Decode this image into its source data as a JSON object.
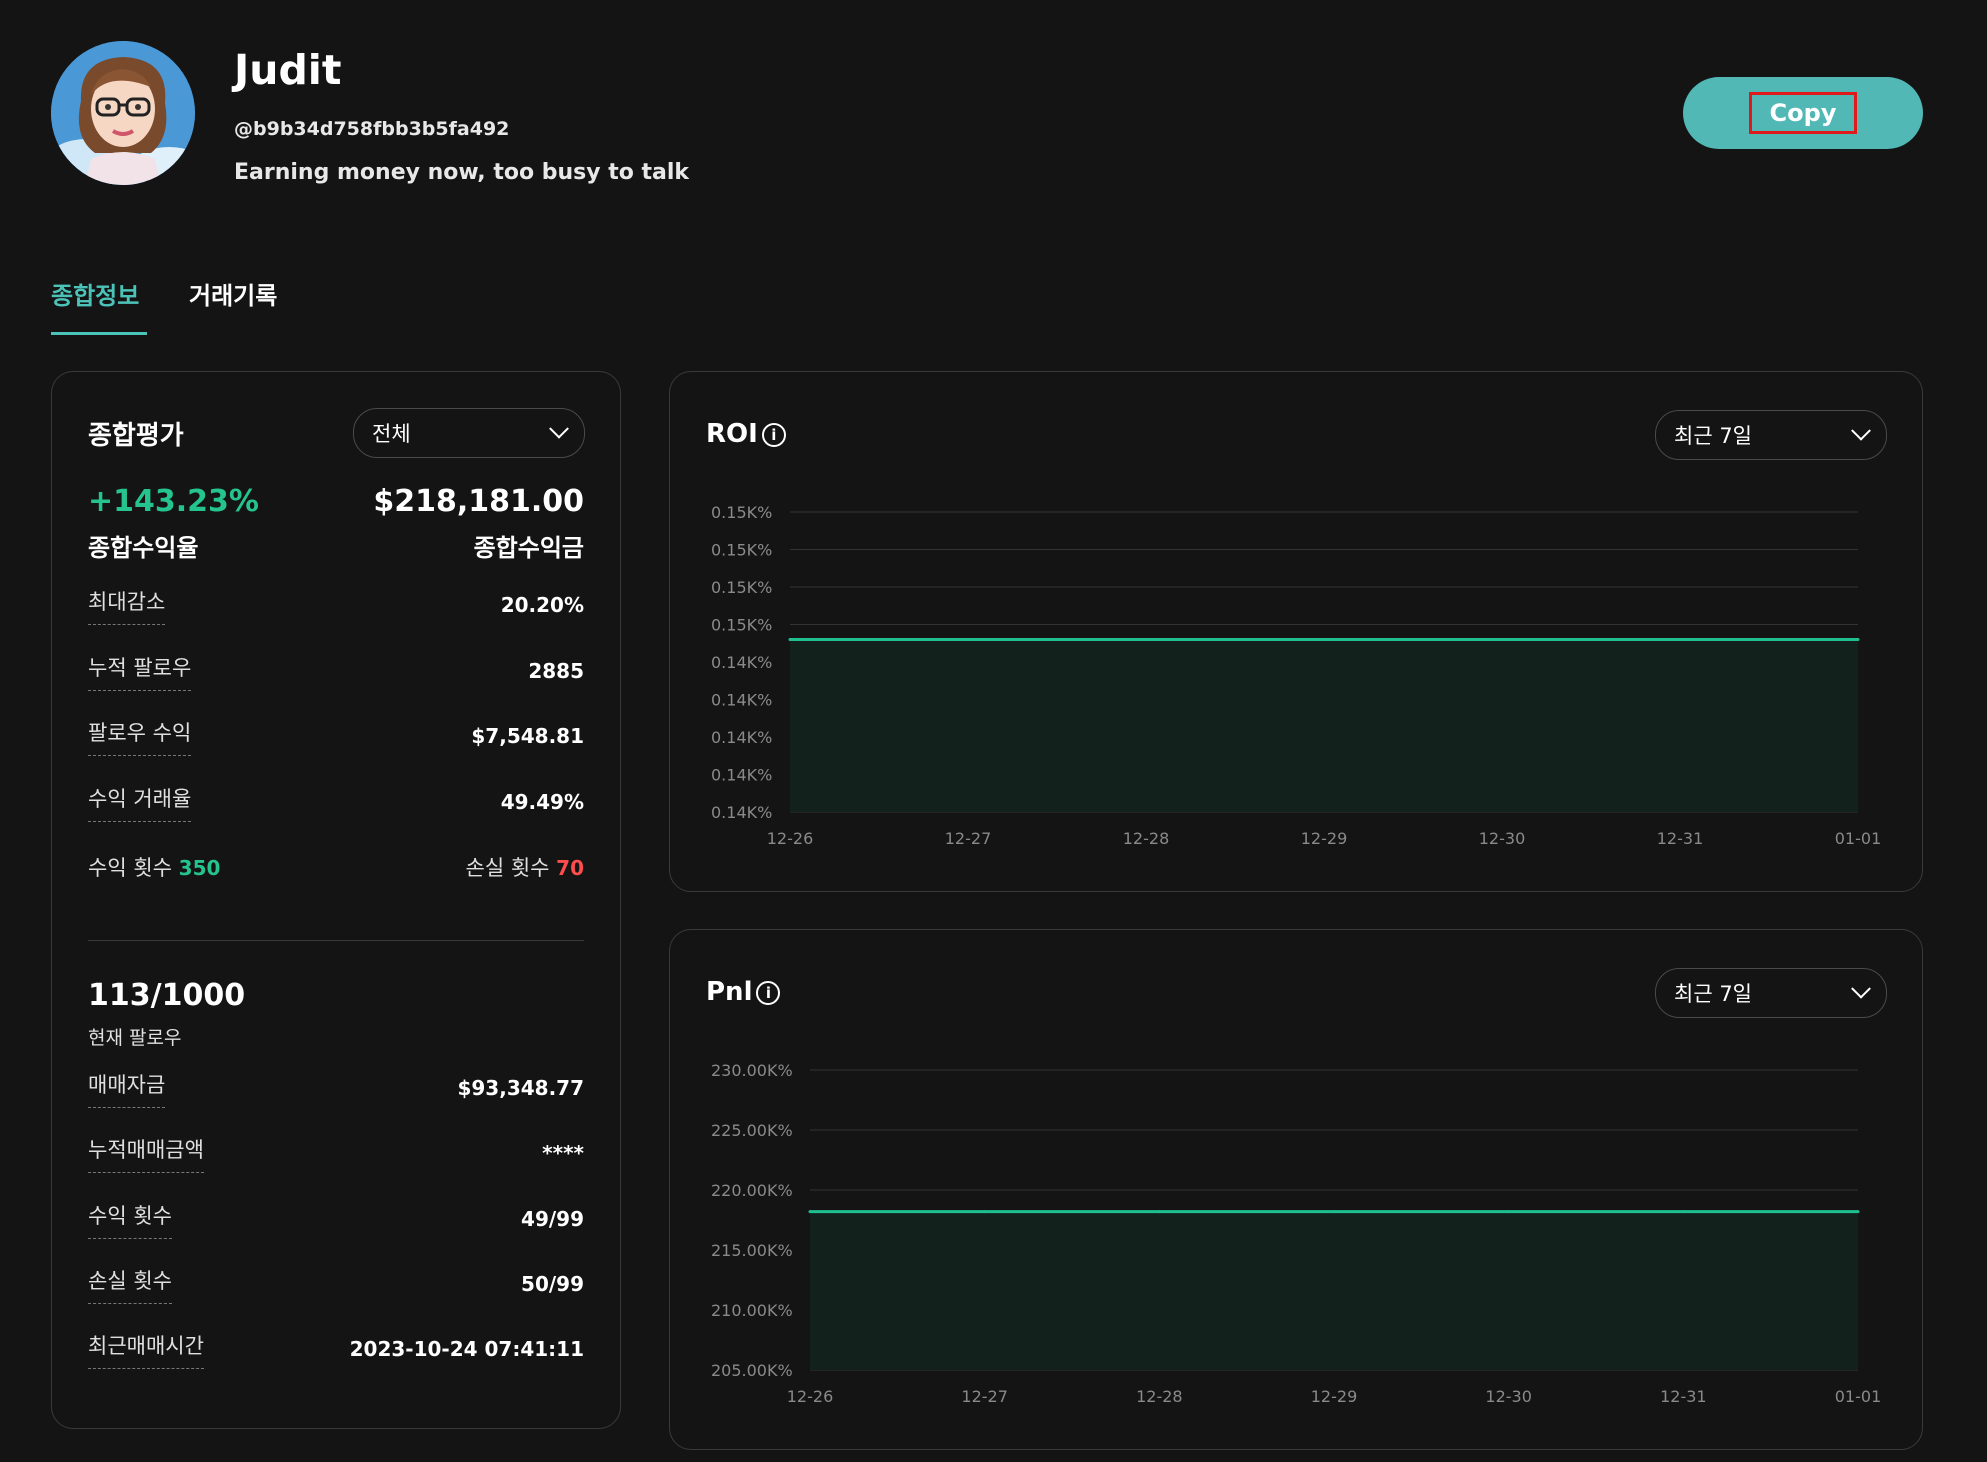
{
  "profile": {
    "name": "Judit",
    "handle": "@b9b34d758fbb3b5fa492",
    "bio": "Earning money now, too busy to talk",
    "copy_label": "Copy"
  },
  "tabs": [
    {
      "label": "종합정보",
      "active": true
    },
    {
      "label": "거래기록",
      "active": false
    }
  ],
  "summary": {
    "title": "종합평가",
    "filter": "전체",
    "total_roi": "+143.23%",
    "total_roi_label": "종합수익율",
    "total_profit": "$218,181.00",
    "total_profit_label": "종합수익금",
    "stats": [
      {
        "label": "최대감소",
        "value": "20.20%"
      },
      {
        "label": "누적 팔로우",
        "value": "2885"
      },
      {
        "label": "팔로우 수익",
        "value": "$7,548.81"
      },
      {
        "label": "수익 거래율",
        "value": "49.49%"
      }
    ],
    "win_label": "수익 횟수",
    "win_count": "350",
    "loss_label": "손실 횟수",
    "loss_count": "70",
    "followers": "113/1000",
    "followers_label": "현재 팔로우",
    "trade_stats": [
      {
        "label": "매매자금",
        "value": "$93,348.77"
      },
      {
        "label": "누적매매금액",
        "value": "****"
      },
      {
        "label": "수익 횟수",
        "value": "49/99"
      },
      {
        "label": "손실 횟수",
        "value": "50/99"
      },
      {
        "label": "최근매매시간",
        "value": "2023-10-24 07:41:11"
      }
    ]
  },
  "roi_chart": {
    "title": "ROI",
    "period": "최근 7일"
  },
  "pnl_chart": {
    "title": "Pnl",
    "period": "최근 7일"
  },
  "chart_data": [
    {
      "type": "area",
      "title": "ROI",
      "x": [
        "12-26",
        "12-27",
        "12-28",
        "12-29",
        "12-30",
        "12-31",
        "01-01"
      ],
      "y_ticks": [
        "0.15K%",
        "0.15K%",
        "0.15K%",
        "0.15K%",
        "0.14K%",
        "0.14K%",
        "0.14K%",
        "0.14K%",
        "0.14K%"
      ],
      "ylim": [
        0,
        8
      ],
      "series": [
        {
          "values": [
            4.6,
            4.6,
            4.6,
            4.6,
            4.6,
            4.6,
            4.6
          ]
        }
      ],
      "color": "#1fbf90",
      "grid": true
    },
    {
      "type": "area",
      "title": "Pnl",
      "x": [
        "12-26",
        "12-27",
        "12-28",
        "12-29",
        "12-30",
        "12-31",
        "01-01"
      ],
      "y_ticks": [
        "230.00K%",
        "225.00K%",
        "220.00K%",
        "215.00K%",
        "210.00K%",
        "205.00K%"
      ],
      "ylim": [
        205,
        230
      ],
      "series": [
        {
          "values": [
            218.2,
            218.2,
            218.2,
            218.2,
            218.2,
            218.2,
            218.2
          ]
        }
      ],
      "color": "#1fbf90",
      "grid": true
    }
  ]
}
